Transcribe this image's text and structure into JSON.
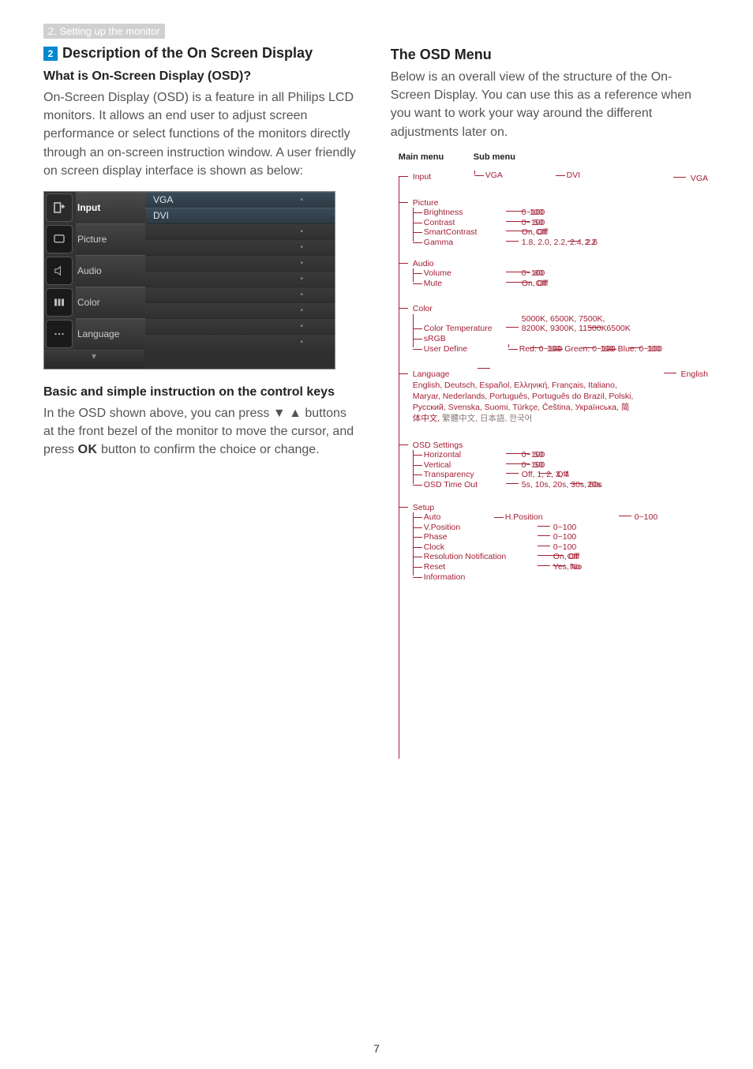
{
  "header_strip": "2. Setting up the monitor",
  "step_badge": "2",
  "left": {
    "title": "Description of the On Screen Display",
    "q1": "What is On-Screen Display (OSD)?",
    "p1": "On-Screen Display (OSD) is a feature in all Philips LCD monitors. It allows an end user to adjust screen performance or select functions of the monitors directly through an on-screen instruction window. A user friendly on screen display interface is shown as below:",
    "osd": {
      "rows": [
        {
          "label": "Input",
          "active": true,
          "right": [
            "VGA",
            "DVI"
          ],
          "hl": true
        },
        {
          "label": "Picture",
          "right": [
            "",
            ""
          ]
        },
        {
          "label": "Audio",
          "right": [
            "",
            ""
          ]
        },
        {
          "label": "Color",
          "right": [
            "",
            ""
          ]
        },
        {
          "label": "Language",
          "right": [
            "",
            ""
          ]
        }
      ],
      "dot": "•"
    },
    "q2": "Basic and simple instruction on the control keys",
    "p2_a": "In the OSD shown above, you can press ▼ ▲ buttons at the front bezel of the monitor to move the cursor, and press ",
    "p2_ok": "OK",
    "p2_b": " button to confirm the choice or change."
  },
  "right": {
    "title": "The OSD Menu",
    "intro": "Below is an overall view of the structure of the On-Screen Display. You can use this as a reference when you want to work your way around the different adjustments later on.",
    "headers": {
      "main": "Main menu",
      "sub": "Sub menu"
    }
  },
  "tree": {
    "input": {
      "label": "Input",
      "items": [
        {
          "l": "VGA"
        },
        {
          "l": "DVI"
        }
      ],
      "default": "VGA"
    },
    "picture": {
      "label": "Picture",
      "items": [
        {
          "l": "Brightness",
          "o": "0~100",
          "d": "100"
        },
        {
          "l": "Contrast",
          "o": "0~100",
          "d": "50"
        },
        {
          "l": "SmartContrast",
          "o": "On, Off",
          "d": "Off"
        },
        {
          "l": "Gamma",
          "o": "1.8, 2.0, 2.2, 2.4, 2.6",
          "d": "2.2"
        }
      ]
    },
    "audio": {
      "label": "Audio",
      "items": [
        {
          "l": "Volume",
          "o": "0~100",
          "d": "80"
        },
        {
          "l": "Mute",
          "o": "On, Off",
          "d": "Off"
        }
      ]
    },
    "color": {
      "label": "Color",
      "temp_label": "Color Temperature",
      "temp_opts": "5000K, 6500K, 7500K, 8200K, 9300K, 11500K",
      "temp_default": "6500K",
      "srgb": "sRGB",
      "user_define": "User Define",
      "rgb": [
        {
          "l": "Red: 0~100",
          "d": "100"
        },
        {
          "l": "Green: 0~100",
          "d": "100"
        },
        {
          "l": "Blue: 0~100",
          "d": "100"
        }
      ]
    },
    "language": {
      "label": "Language",
      "body_red": "English, Deutsch, Español, Ελληνική, Français, Italiano, Maryar, Nederlands, Português, Português do Brazil, Polski, Русский, Svenska, Suomi, Türkçe, Čeština, Українська, 简体中文,",
      "body_grey": "繁體中文, 日本語, 한국어",
      "default": "English"
    },
    "osd_settings": {
      "label": "OSD Settings",
      "items": [
        {
          "l": "Horizontal",
          "o": "0~100",
          "d": "50"
        },
        {
          "l": "Vertical",
          "o": "0~100",
          "d": "50"
        },
        {
          "l": "Transparency",
          "o": "Off, 1, 2, 3, 4",
          "d": "Off"
        },
        {
          "l": "OSD Time Out",
          "o": "5s, 10s, 20s, 30s, 60s",
          "d": "20s"
        }
      ]
    },
    "setup": {
      "label": "Setup",
      "items": [
        {
          "l": "Auto"
        },
        {
          "l": "H.Position",
          "o": "0~100"
        },
        {
          "l": "V.Position",
          "o": "0~100"
        },
        {
          "l": "Phase",
          "o": "0~100"
        },
        {
          "l": "Clock",
          "o": "0~100"
        },
        {
          "l": "Resolution Notification",
          "o": "On, Off",
          "d": "Off"
        },
        {
          "l": "Reset",
          "o": "Yes, No",
          "d": "No"
        },
        {
          "l": "Information"
        }
      ]
    }
  },
  "page_number": "7"
}
